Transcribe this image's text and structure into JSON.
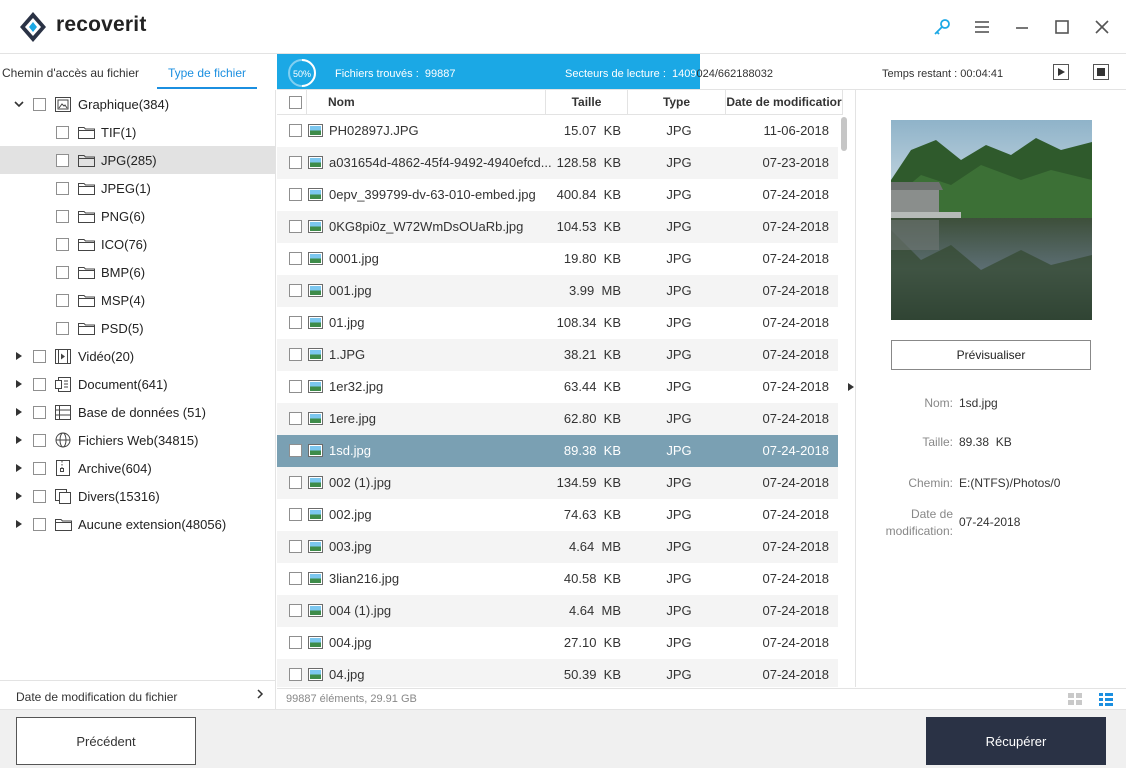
{
  "app": {
    "name": "recoverit",
    "brand_color": "#2a3245",
    "accent": "#1ba8e5"
  },
  "window_controls": [
    "key-icon",
    "menu-icon",
    "minimize-icon",
    "maximize-icon",
    "close-icon"
  ],
  "left_tabs": {
    "path_tab": "Chemin d'accès au fichier",
    "type_tab": "Type de fichier"
  },
  "tree": [
    {
      "label": "Graphique(384)",
      "icon": "image-icon",
      "level": 0,
      "expanded": true
    },
    {
      "label": "TIF(1)",
      "icon": "folder-icon",
      "level": 1
    },
    {
      "label": "JPG(285)",
      "icon": "folder-icon",
      "level": 1,
      "selected": true
    },
    {
      "label": "JPEG(1)",
      "icon": "folder-icon",
      "level": 1
    },
    {
      "label": "PNG(6)",
      "icon": "folder-icon",
      "level": 1
    },
    {
      "label": "ICO(76)",
      "icon": "folder-icon",
      "level": 1
    },
    {
      "label": "BMP(6)",
      "icon": "folder-icon",
      "level": 1
    },
    {
      "label": "MSP(4)",
      "icon": "folder-icon",
      "level": 1
    },
    {
      "label": "PSD(5)",
      "icon": "folder-icon",
      "level": 1
    },
    {
      "label": "Vidéo(20)",
      "icon": "video-icon",
      "level": 0
    },
    {
      "label": "Document(641)",
      "icon": "document-icon",
      "level": 0
    },
    {
      "label": "Base de données (51)",
      "icon": "database-icon",
      "level": 0
    },
    {
      "label": "Fichiers Web(34815)",
      "icon": "globe-icon",
      "level": 0
    },
    {
      "label": "Archive(604)",
      "icon": "archive-icon",
      "level": 0
    },
    {
      "label": "Divers(15316)",
      "icon": "misc-icon",
      "level": 0
    },
    {
      "label": "Aucune extension(48056)",
      "icon": "folder-icon",
      "level": 0
    }
  ],
  "date_filter": {
    "label": "Date de modification du fichier"
  },
  "progress": {
    "percent_label": "50%",
    "percent": 50,
    "found_label": "Fichiers trouvés :",
    "found_value": "99887",
    "sectors_label": "Secteurs de lecture :",
    "sectors_value": "1409024/662188032",
    "remaining_label": "Temps restant :",
    "remaining_value": "00:04:41"
  },
  "table": {
    "headers": {
      "name": "Nom",
      "size": "Taille",
      "type": "Type",
      "date": "Date de modificatior"
    },
    "rows": [
      {
        "name": "PH02897J.JPG",
        "size": "15.07  KB",
        "type": "JPG",
        "date": "11-06-2018"
      },
      {
        "name": "a031654d-4862-45f4-9492-4940efcd...",
        "size": "128.58  KB",
        "type": "JPG",
        "date": "07-23-2018"
      },
      {
        "name": "0epv_399799-dv-63-010-embed.jpg",
        "size": "400.84  KB",
        "type": "JPG",
        "date": "07-24-2018"
      },
      {
        "name": "0KG8pi0z_W72WmDsOUaRb.jpg",
        "size": "104.53  KB",
        "type": "JPG",
        "date": "07-24-2018"
      },
      {
        "name": "0001.jpg",
        "size": "19.80  KB",
        "type": "JPG",
        "date": "07-24-2018"
      },
      {
        "name": "001.jpg",
        "size": "3.99  MB",
        "type": "JPG",
        "date": "07-24-2018"
      },
      {
        "name": "01.jpg",
        "size": "108.34  KB",
        "type": "JPG",
        "date": "07-24-2018"
      },
      {
        "name": "1.JPG",
        "size": "38.21  KB",
        "type": "JPG",
        "date": "07-24-2018"
      },
      {
        "name": "1er32.jpg",
        "size": "63.44  KB",
        "type": "JPG",
        "date": "07-24-2018"
      },
      {
        "name": "1ere.jpg",
        "size": "62.80  KB",
        "type": "JPG",
        "date": "07-24-2018"
      },
      {
        "name": "1sd.jpg",
        "size": "89.38  KB",
        "type": "JPG",
        "date": "07-24-2018",
        "selected": true
      },
      {
        "name": "002 (1).jpg",
        "size": "134.59  KB",
        "type": "JPG",
        "date": "07-24-2018"
      },
      {
        "name": "002.jpg",
        "size": "74.63  KB",
        "type": "JPG",
        "date": "07-24-2018"
      },
      {
        "name": "003.jpg",
        "size": "4.64  MB",
        "type": "JPG",
        "date": "07-24-2018"
      },
      {
        "name": "3lian216.jpg",
        "size": "40.58  KB",
        "type": "JPG",
        "date": "07-24-2018"
      },
      {
        "name": "004 (1).jpg",
        "size": "4.64  MB",
        "type": "JPG",
        "date": "07-24-2018"
      },
      {
        "name": "004.jpg",
        "size": "27.10  KB",
        "type": "JPG",
        "date": "07-24-2018"
      },
      {
        "name": "04.jpg",
        "size": "50.39  KB",
        "type": "JPG",
        "date": "07-24-2018"
      }
    ]
  },
  "status": {
    "count_text": "99887 éléments, 29.91  GB"
  },
  "preview": {
    "button_label": "Prévisualiser",
    "name_label": "Nom:",
    "name_value": "1sd.jpg",
    "size_label": "Taille:",
    "size_value": "89.38  KB",
    "path_label": "Chemin:",
    "path_value": "E:(NTFS)/Photos/0",
    "date_label": "Date de modification:",
    "date_value": "07-24-2018"
  },
  "footer": {
    "prev_label": "Précédent",
    "recover_label": "Récupérer"
  }
}
